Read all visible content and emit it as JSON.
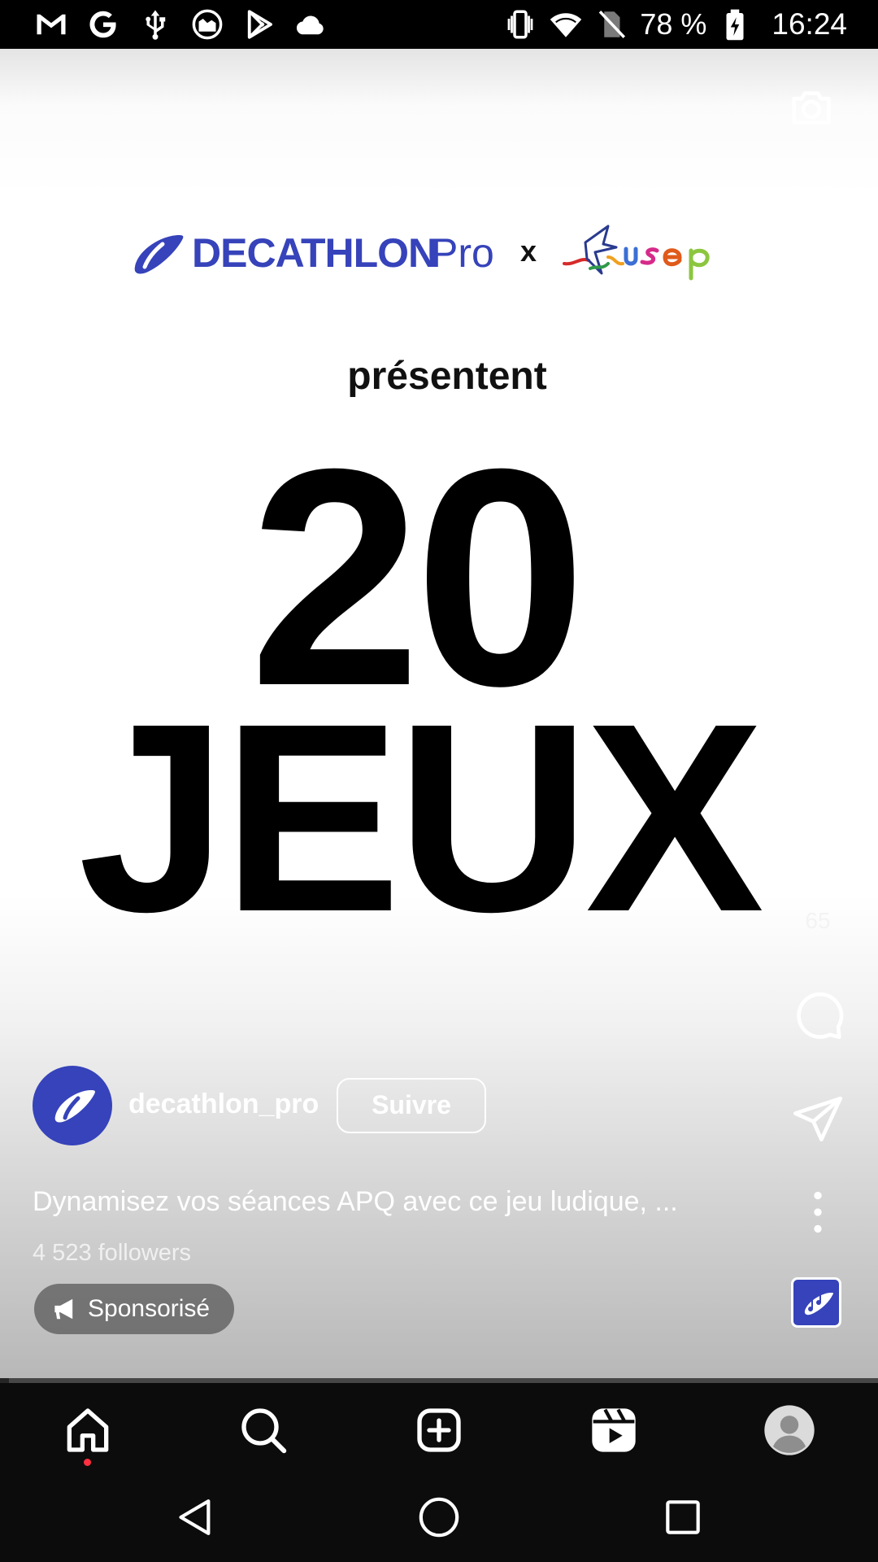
{
  "status_bar": {
    "left_icons": [
      "gmail-icon",
      "google-icon",
      "usb-icon",
      "ar-icon",
      "play-store-icon",
      "cloud-icon"
    ],
    "right_icons": [
      "vibrate-icon",
      "wifi-icon",
      "no-sim-icon",
      "battery-charging-icon"
    ],
    "battery": "78 %",
    "time": "16:24"
  },
  "reel": {
    "creative": {
      "brand_logo_text": "DECATHLON",
      "brand_logo_suffix": "Pro",
      "collab_separator": "x",
      "partner_logo_text": "usep",
      "headline_small": "présentent",
      "headline_number": "20",
      "headline_word": "JEUX"
    },
    "camera_icon": "camera-icon",
    "actions": {
      "like_icon": "heart-icon",
      "like_count": "65",
      "comment_icon": "comment-icon",
      "share_icon": "send-icon",
      "more_icon": "more-vertical-icon"
    },
    "account": {
      "username": "decathlon_pro",
      "follow_label": "Suivre",
      "caption": "Dynamisez vos séances APQ avec ce jeu ludique, ...",
      "followers": "4 523 followers"
    },
    "sponsored_label": "Sponsorisé",
    "audio_icon": "music-note-icon",
    "progress": 0.01
  },
  "bottom_nav": {
    "items": [
      "home-icon",
      "search-icon",
      "create-icon",
      "reels-icon",
      "profile-icon"
    ],
    "active": "home-icon"
  },
  "system_nav": [
    "back-icon",
    "home-circle-icon",
    "recents-icon"
  ],
  "colors": {
    "brand": "#3643ba",
    "nav_background": "#0c0c0c",
    "notification_dot": "#ff3040"
  }
}
